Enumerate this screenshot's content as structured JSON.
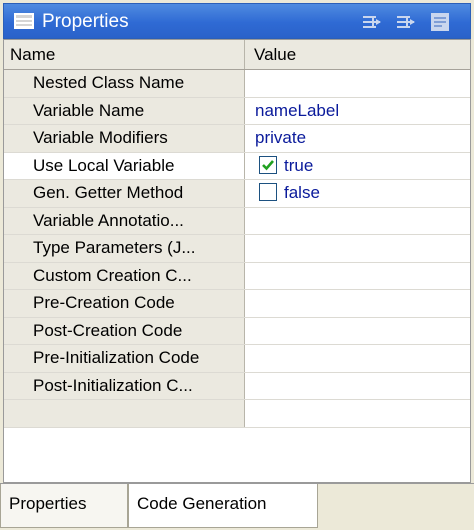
{
  "window": {
    "title": "Properties",
    "icons": {
      "title": "properties-list-icon",
      "btn1": "show-categories-icon",
      "btn2": "show-advanced-icon",
      "btn3": "menu-icon"
    }
  },
  "table": {
    "headers": {
      "name": "Name",
      "value": "Value"
    },
    "rows": [
      {
        "name": "Nested Class Name",
        "value": ""
      },
      {
        "name": "Variable Name",
        "value": "nameLabel"
      },
      {
        "name": "Variable Modifiers",
        "value": "private"
      },
      {
        "name": "Use Local Variable",
        "value": "true",
        "checked": true
      },
      {
        "name": "Gen. Getter Method",
        "value": "false",
        "checked": false
      },
      {
        "name": "Variable Annotatio...",
        "value": ""
      },
      {
        "name": "Type Parameters (J...",
        "value": ""
      },
      {
        "name": "Custom Creation C...",
        "value": ""
      },
      {
        "name": "Pre-Creation Code",
        "value": ""
      },
      {
        "name": "Post-Creation Code",
        "value": ""
      },
      {
        "name": "Pre-Initialization Code",
        "value": ""
      },
      {
        "name": "Post-Initialization C...",
        "value": ""
      },
      {
        "name": "",
        "value": ""
      }
    ]
  },
  "tabs": {
    "properties": "Properties",
    "code_generation": "Code Generation"
  },
  "colors": {
    "title_bar": "#2f6ad4",
    "value_text": "#0a1a9b",
    "checkmark": "#21a121"
  }
}
